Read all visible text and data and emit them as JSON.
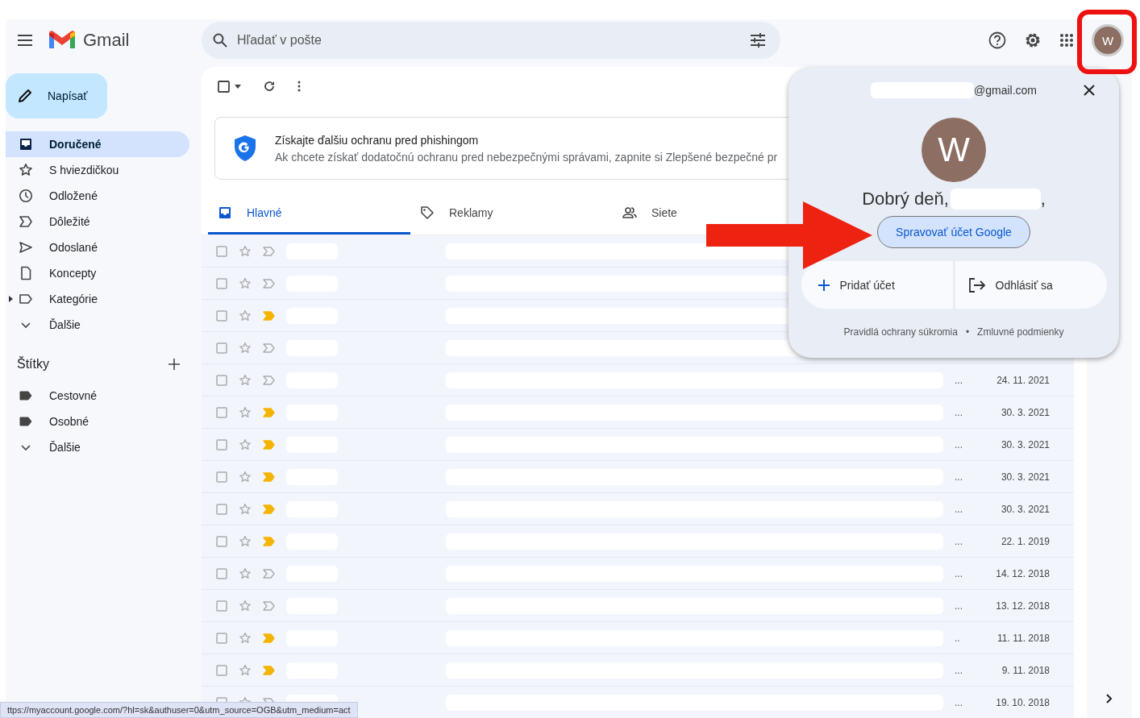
{
  "header": {
    "app_name": "Gmail",
    "search": {
      "placeholder": "Hľadať v pošte"
    },
    "avatar_letter": "W"
  },
  "compose": {
    "label": "Napísať"
  },
  "sidebar": {
    "items": [
      {
        "label": "Doručené",
        "selected": true
      },
      {
        "label": "S hviezdičkou",
        "selected": false
      },
      {
        "label": "Odložené",
        "selected": false
      },
      {
        "label": "Dôležité",
        "selected": false
      },
      {
        "label": "Odoslané",
        "selected": false
      },
      {
        "label": "Koncepty",
        "selected": false
      },
      {
        "label": "Kategórie",
        "selected": false
      },
      {
        "label": "Ďalšie",
        "selected": false
      }
    ],
    "labels_title": "Štítky",
    "labels": [
      {
        "label": "Cestovné",
        "selected": false
      },
      {
        "label": "Osobné",
        "selected": false
      },
      {
        "label": "Ďalšie",
        "selected": false
      }
    ]
  },
  "banner": {
    "title": "Získajte ďalšiu ochranu pred phishingom",
    "text": "Ak chcete získať dodatočnú ochranu pred nebezpečnými správami, zapnite si Zlepšené bezpečné pr"
  },
  "toolbar": {
    "select_all": {
      "checked": false
    }
  },
  "tabs": [
    {
      "label": "Hlavné",
      "selected": true
    },
    {
      "label": "Reklamy",
      "selected": false
    },
    {
      "label": "Siete",
      "selected": false
    }
  ],
  "rows": [
    {
      "checked": false,
      "important": false
    },
    {
      "checked": false,
      "important": false
    },
    {
      "checked": false,
      "important": true
    },
    {
      "checked": false,
      "important": false
    },
    {
      "checked": false,
      "important": false,
      "ellipsis": "...",
      "date": "24. 11. 2021"
    },
    {
      "checked": false,
      "important": true,
      "ellipsis": "...",
      "date": "30. 3. 2021"
    },
    {
      "checked": false,
      "important": true,
      "ellipsis": "...",
      "date": "30. 3. 2021"
    },
    {
      "checked": false,
      "important": true,
      "ellipsis": "...",
      "date": "30. 3. 2021"
    },
    {
      "checked": false,
      "important": true,
      "ellipsis": "...",
      "date": "30. 3. 2021"
    },
    {
      "checked": false,
      "important": true,
      "ellipsis": "...",
      "date": "22. 1. 2019"
    },
    {
      "checked": false,
      "important": false,
      "ellipsis": "...",
      "date": "14. 12. 2018"
    },
    {
      "checked": false,
      "important": false,
      "ellipsis": "...",
      "date": "13. 12. 2018"
    },
    {
      "checked": false,
      "important": true,
      "ellipsis": "..",
      "date": "11. 11. 2018"
    },
    {
      "checked": false,
      "important": true,
      "ellipsis": "...",
      "date": "9. 11. 2018"
    },
    {
      "checked": false,
      "important": false,
      "ellipsis": "...",
      "date": "19. 10. 2018"
    }
  ],
  "account_popup": {
    "email_domain": "@gmail.com",
    "avatar_letter": "W",
    "greeting": "Dobrý deň,",
    "greeting_end": ",",
    "manage_button": "Spravovať účet Google",
    "add_account": "Pridať účet",
    "sign_out": "Odhlásiť sa",
    "privacy_link": "Pravidlá ochrany súkromia",
    "separator": "•",
    "terms_link": "Zmluvné podmienky"
  },
  "status_bar": {
    "url": "ttps://myaccount.google.com/?hl=sk&authuser=0&utm_source=OGB&utm_medium=act"
  }
}
